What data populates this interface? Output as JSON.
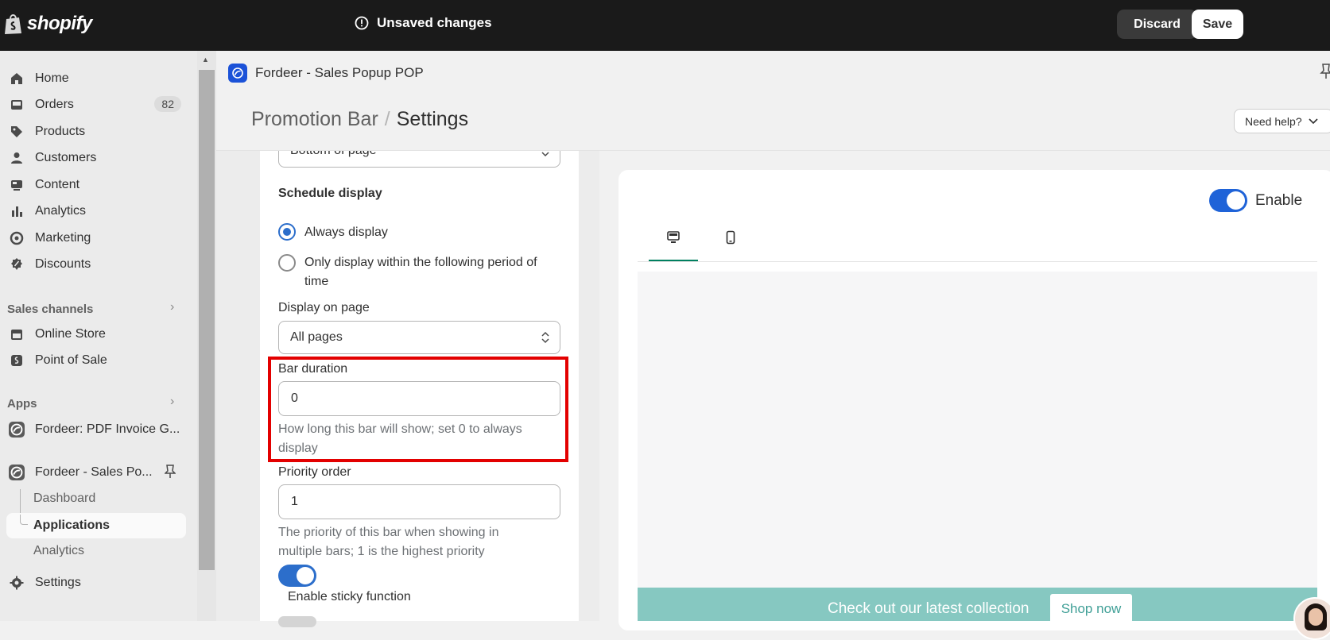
{
  "topbar": {
    "brand": "shopify",
    "status": "Unsaved changes",
    "discard_label": "Discard",
    "save_label": "Save"
  },
  "sidebar": {
    "items": [
      {
        "label": "Home",
        "icon": "home-icon"
      },
      {
        "label": "Orders",
        "icon": "orders-icon",
        "badge": "82"
      },
      {
        "label": "Products",
        "icon": "tag-icon"
      },
      {
        "label": "Customers",
        "icon": "person-icon"
      },
      {
        "label": "Content",
        "icon": "content-icon"
      },
      {
        "label": "Analytics",
        "icon": "bar-chart-icon"
      },
      {
        "label": "Marketing",
        "icon": "target-icon"
      },
      {
        "label": "Discounts",
        "icon": "discount-icon"
      }
    ],
    "sales_channels_title": "Sales channels",
    "channels": [
      {
        "label": "Online Store",
        "icon": "store-icon"
      },
      {
        "label": "Point of Sale",
        "icon": "pos-icon"
      }
    ],
    "apps_title": "Apps",
    "apps": [
      {
        "label": "Fordeer: PDF Invoice G..."
      },
      {
        "label": "Fordeer - Sales Po..."
      }
    ],
    "subitems": [
      "Dashboard",
      "Applications",
      "Analytics"
    ],
    "settings_label": "Settings"
  },
  "app_header": {
    "name": "Fordeer - Sales Popup POP"
  },
  "page": {
    "breadcrumb": "Promotion Bar",
    "title": "Settings",
    "help_label": "Need help?"
  },
  "settings": {
    "position_value": "Bottom of page",
    "schedule_title": "Schedule display",
    "radio_always": "Always display",
    "radio_period": "Only display within the following period of time",
    "display_on_page_label": "Display on page",
    "display_on_page_value": "All pages",
    "bar_duration_label": "Bar duration",
    "bar_duration_value": "0",
    "bar_duration_help": "How long this bar will show; set 0 to always display",
    "priority_label": "Priority order",
    "priority_value": "1",
    "priority_help": "The priority of this bar when showing in multiple bars; 1 is the highest priority",
    "sticky_label": "Enable sticky function"
  },
  "preview": {
    "enable_label": "Enable",
    "promo_text": "Check out our latest collection",
    "shop_button": "Shop now"
  },
  "colors": {
    "accent": "#2c6ecb",
    "highlight": "#e30000",
    "promo_bar": "#86c8c1",
    "tab_active": "#008060"
  }
}
